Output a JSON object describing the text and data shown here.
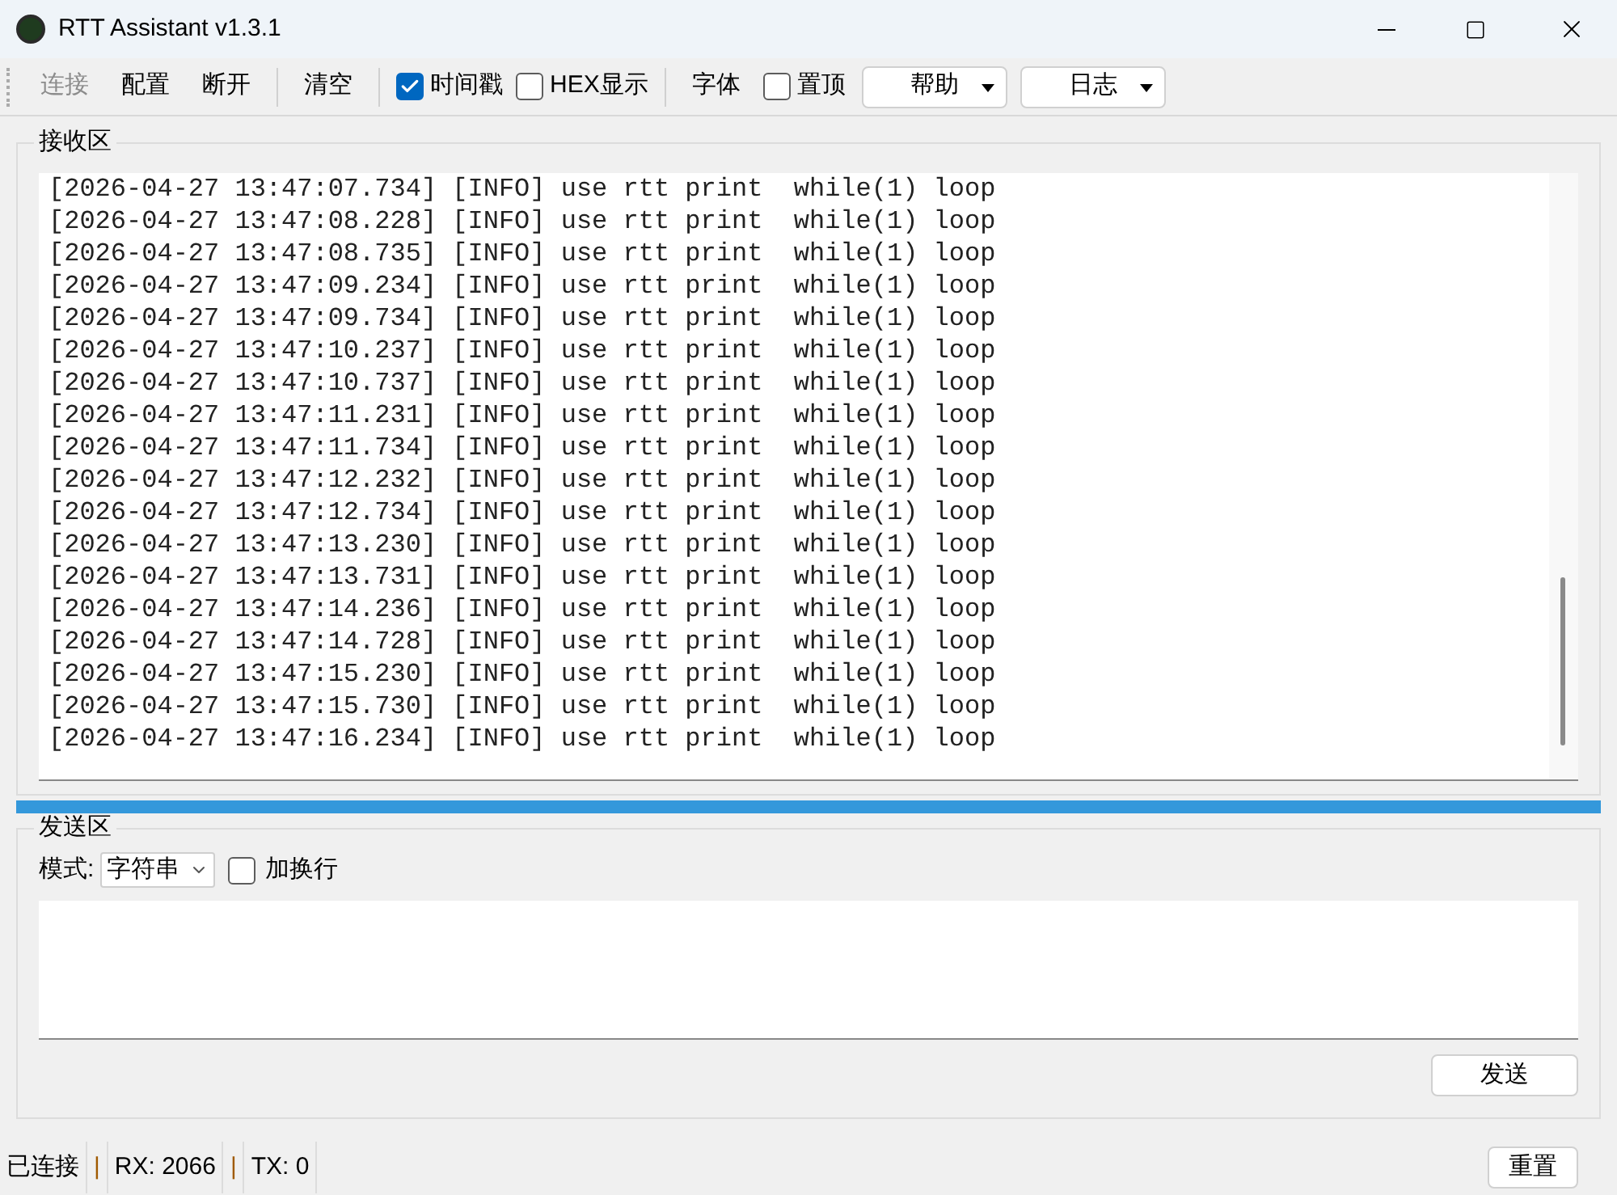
{
  "window": {
    "title": "RTT Assistant v1.3.1"
  },
  "toolbar": [
    {
      "kind": "button",
      "label": "连接",
      "disabled": true
    },
    {
      "kind": "button",
      "label": "配置",
      "disabled": false
    },
    {
      "kind": "button",
      "label": "断开",
      "disabled": false
    },
    {
      "kind": "separator"
    },
    {
      "kind": "button",
      "label": "清空",
      "disabled": false
    },
    {
      "kind": "separator"
    },
    {
      "kind": "checkbox",
      "label": "时间戳",
      "checked": true
    },
    {
      "kind": "checkbox",
      "label": "HEX显示",
      "checked": false
    },
    {
      "kind": "separator"
    },
    {
      "kind": "button",
      "label": "字体",
      "disabled": false
    },
    {
      "kind": "checkbox",
      "label": "置顶",
      "checked": false
    },
    {
      "kind": "dropdown",
      "label": "帮助"
    },
    {
      "kind": "dropdown",
      "label": "日志"
    }
  ],
  "receive": {
    "title": "接收区",
    "lines": [
      "[2026-04-27 13:47:07.734] [INFO] use rtt print  while(1) loop",
      "[2026-04-27 13:47:08.228] [INFO] use rtt print  while(1) loop",
      "[2026-04-27 13:47:08.735] [INFO] use rtt print  while(1) loop",
      "[2026-04-27 13:47:09.234] [INFO] use rtt print  while(1) loop",
      "[2026-04-27 13:47:09.734] [INFO] use rtt print  while(1) loop",
      "[2026-04-27 13:47:10.237] [INFO] use rtt print  while(1) loop",
      "[2026-04-27 13:47:10.737] [INFO] use rtt print  while(1) loop",
      "[2026-04-27 13:47:11.231] [INFO] use rtt print  while(1) loop",
      "[2026-04-27 13:47:11.734] [INFO] use rtt print  while(1) loop",
      "[2026-04-27 13:47:12.232] [INFO] use rtt print  while(1) loop",
      "[2026-04-27 13:47:12.734] [INFO] use rtt print  while(1) loop",
      "[2026-04-27 13:47:13.230] [INFO] use rtt print  while(1) loop",
      "[2026-04-27 13:47:13.731] [INFO] use rtt print  while(1) loop",
      "[2026-04-27 13:47:14.236] [INFO] use rtt print  while(1) loop",
      "[2026-04-27 13:47:14.728] [INFO] use rtt print  while(1) loop",
      "[2026-04-27 13:47:15.230] [INFO] use rtt print  while(1) loop",
      "[2026-04-27 13:47:15.730] [INFO] use rtt print  while(1) loop",
      "[2026-04-27 13:47:16.234] [INFO] use rtt print  while(1) loop"
    ]
  },
  "send": {
    "title": "发送区",
    "mode_label": "模式:",
    "mode_value": "字符串",
    "newline": {
      "label": "加换行",
      "checked": false
    },
    "send_button": "发送"
  },
  "status_bar": {
    "items": [
      "已连接",
      "|",
      "RX: 2066",
      "|",
      "TX: 0"
    ],
    "reset_button": "重置"
  }
}
